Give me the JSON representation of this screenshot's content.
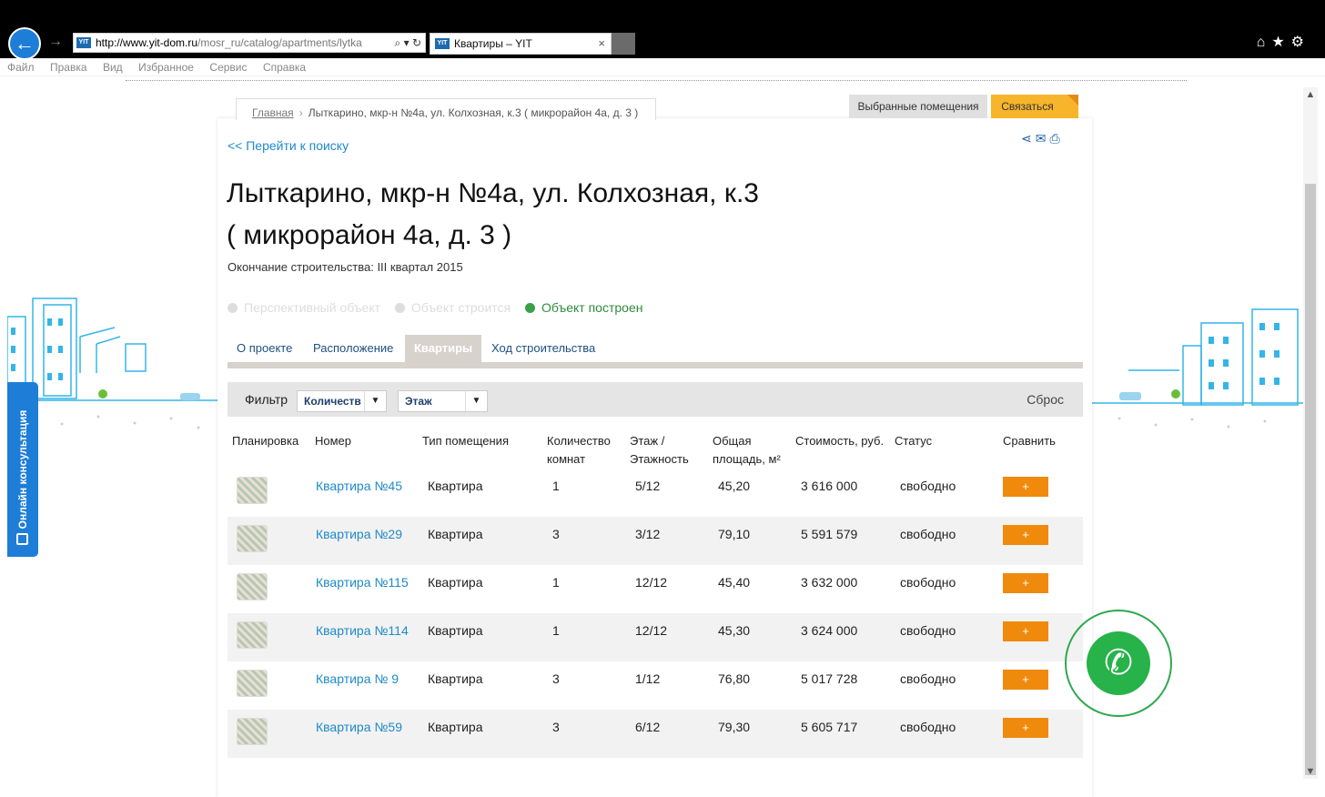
{
  "browser": {
    "url_host": "http://www.yit-dom.ru",
    "url_rest": "/mosr_ru/catalog/apartments/lytka",
    "favicon": "YIT",
    "tab_title": "Квартиры – YIT",
    "tab_close": "×",
    "menu": [
      "Файл",
      "Правка",
      "Вид",
      "Избранное",
      "Сервис",
      "Справка"
    ]
  },
  "breadcrumb": {
    "home": "Главная",
    "separator": "›",
    "current": "Лыткарино, мкр-н №4а, ул. Колхозная, к.3 ( микрорайон 4а, д. 3 )"
  },
  "header_buttons": {
    "favorites": "Выбранные помещения",
    "contact": "Связаться"
  },
  "back_link": "<< Перейти к поиску",
  "title_line1": "Лыткарино, мкр-н №4а, ул. Колхозная, к.3",
  "title_line2": "( микрорайон 4а, д. 3 )",
  "completion": "Окончание строительства: III квартал 2015",
  "stages": [
    {
      "label": "Перспективный объект",
      "active": false
    },
    {
      "label": "Объект строится",
      "active": false
    },
    {
      "label": "Объект построен",
      "active": true
    }
  ],
  "tabs": [
    {
      "label": "О проекте",
      "active": false
    },
    {
      "label": "Расположение",
      "active": false
    },
    {
      "label": "Квартиры",
      "active": true
    },
    {
      "label": "Ход строительства",
      "active": false
    }
  ],
  "filter": {
    "label": "Фильтр",
    "rooms_select": "Количеств",
    "floor_select": "Этаж",
    "reset": "Сброс"
  },
  "table": {
    "headers": {
      "plan": "Планировка",
      "number": "Номер",
      "type": "Тип помещения",
      "rooms": "Количество комнат",
      "floor": "Этаж / Этажность",
      "area": "Общая площадь, м²",
      "price": "Стоимость, руб.",
      "status": "Статус",
      "compare": "Сравнить"
    },
    "compare_label": "+",
    "rows": [
      {
        "number": "Квартира №45",
        "type": "Квартира",
        "rooms": "1",
        "floor": "5/12",
        "area": "45,20",
        "price": "3 616 000",
        "status": "свободно"
      },
      {
        "number": "Квартира №29",
        "type": "Квартира",
        "rooms": "3",
        "floor": "3/12",
        "area": "79,10",
        "price": "5 591 579",
        "status": "свободно"
      },
      {
        "number": "Квартира №115",
        "type": "Квартира",
        "rooms": "1",
        "floor": "12/12",
        "area": "45,40",
        "price": "3 632 000",
        "status": "свободно"
      },
      {
        "number": "Квартира №114",
        "type": "Квартира",
        "rooms": "1",
        "floor": "12/12",
        "area": "45,30",
        "price": "3 624 000",
        "status": "свободно"
      },
      {
        "number": "Квартира № 9",
        "type": "Квартира",
        "rooms": "3",
        "floor": "1/12",
        "area": "76,80",
        "price": "5 017 728",
        "status": "свободно"
      },
      {
        "number": "Квартира №59",
        "type": "Квартира",
        "rooms": "3",
        "floor": "6/12",
        "area": "79,30",
        "price": "5 605 717",
        "status": "свободно"
      }
    ]
  },
  "side_widget": "Онлайн консультация",
  "icons": {
    "back": "back-arrow-icon",
    "forward": "forward-arrow-icon",
    "search": "search-icon",
    "refresh": "refresh-icon",
    "home": "home-icon",
    "favorites": "star-icon",
    "settings": "gear-icon",
    "share": "share-icon",
    "mail": "mail-icon",
    "print": "print-icon",
    "call": "phone-icon"
  },
  "colors": {
    "link": "#1e8ac9",
    "accent_orange": "#ef8a0c",
    "contact_yellow": "#f6b52a",
    "built_green": "#3aa048",
    "side_tab_blue": "#1e7dd6"
  }
}
